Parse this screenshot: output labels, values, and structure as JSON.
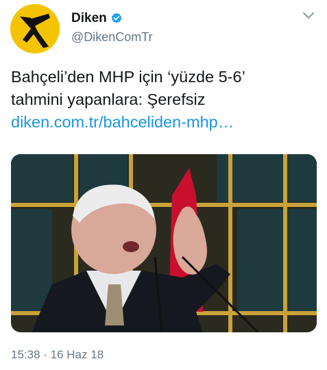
{
  "account": {
    "display_name": "Diken",
    "handle": "@DikenComTr",
    "verified_icon": "verified-badge-icon",
    "avatar_icon": "diken-logo-icon",
    "brand_color": "#f5c400"
  },
  "tweet": {
    "text_line_1": "Bahçeli’den MHP için ‘yüzde 5-6’",
    "text_line_2": "tahmini yapanlara: Şerefsiz",
    "link_text": "diken.com.tr/bahceliden-mhp…",
    "link_color": "#1b95e0"
  },
  "media": {
    "description_icon": "photo-image"
  },
  "meta": {
    "timestamp": "15:38 · 16 Haz 18"
  },
  "menu": {
    "icon": "chevron-down-icon"
  }
}
